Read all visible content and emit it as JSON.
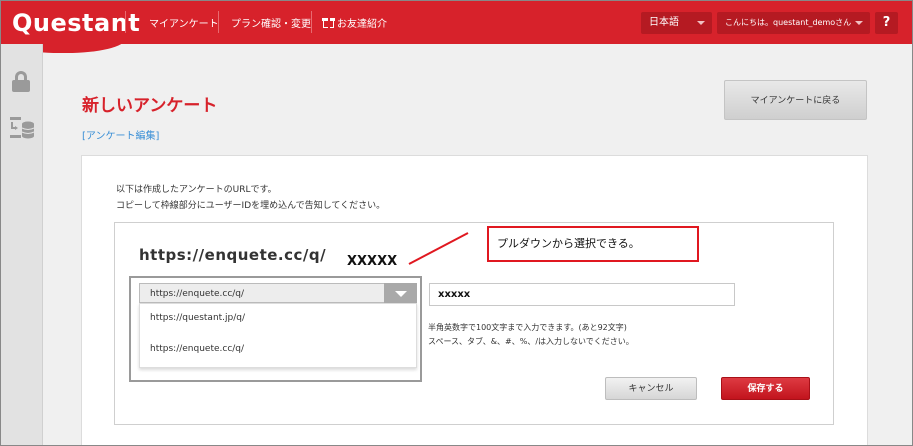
{
  "header": {
    "logo": "Questant",
    "nav": [
      "マイアンケート",
      "プラン確認・変更",
      "お友達紹介"
    ],
    "language": "日本語",
    "greeting": "こんにちは。questant_demoさん",
    "help": "?"
  },
  "page": {
    "title": "新しいアンケート",
    "back_button": "マイアンケートに戻る",
    "breadcrumb": "[アンケート編集]",
    "desc_line1": "以下は作成したアンケートのURLです。",
    "desc_line2": "コピーして枠線部分にユーザーIDを埋め込んで告知してください。",
    "url_display": "https://enquete.cc/q/",
    "xxxxx_label": "XXXXX"
  },
  "callout": {
    "text": "プルダウンから選択できる。"
  },
  "domain_select": {
    "selected": "https://enquete.cc/q/",
    "options": [
      "https://questant.jp/q/",
      "https://enquete.cc/q/"
    ]
  },
  "id_field": {
    "value": "xxxxx"
  },
  "help_text": {
    "line1": "半角英数字で100文字まで入力できます。(あと92文字)",
    "line2": "スペース、タブ、&、#、%、/は入力しないでください。"
  },
  "actions": {
    "cancel": "キャンセル",
    "save": "保存する"
  },
  "colors": {
    "brand_red": "#d7222b",
    "callout_border": "#e01820",
    "link_blue": "#3a8fd6"
  }
}
